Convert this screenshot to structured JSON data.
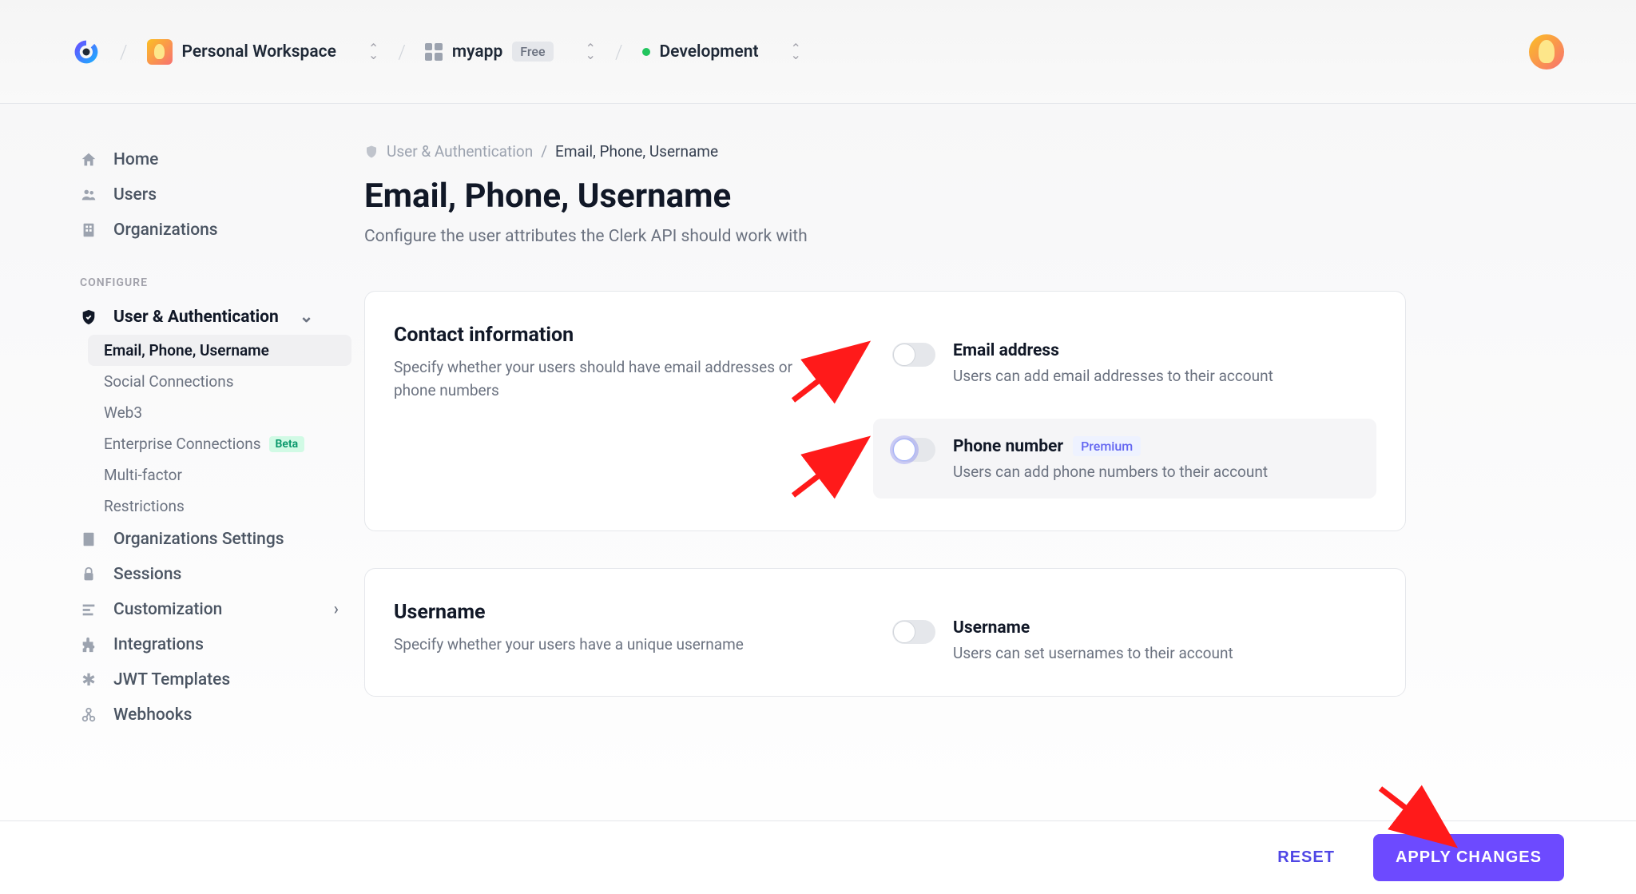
{
  "topbar": {
    "workspace": "Personal Workspace",
    "app": "myapp",
    "app_badge": "Free",
    "environment": "Development"
  },
  "sidebar": {
    "top": [
      {
        "icon": "home",
        "label": "Home"
      },
      {
        "icon": "users",
        "label": "Users"
      },
      {
        "icon": "org",
        "label": "Organizations"
      }
    ],
    "section": "CONFIGURE",
    "auth_label": "User & Authentication",
    "auth_items": [
      {
        "label": "Email, Phone, Username",
        "active": true
      },
      {
        "label": "Social Connections"
      },
      {
        "label": "Web3"
      },
      {
        "label": "Enterprise Connections",
        "badge": "Beta"
      },
      {
        "label": "Multi-factor"
      },
      {
        "label": "Restrictions"
      }
    ],
    "rest": [
      {
        "icon": "org",
        "label": "Organizations Settings"
      },
      {
        "icon": "lock",
        "label": "Sessions"
      },
      {
        "icon": "custom",
        "label": "Customization",
        "chevron": true
      },
      {
        "icon": "puzzle",
        "label": "Integrations"
      },
      {
        "icon": "jwt",
        "label": "JWT Templates"
      },
      {
        "icon": "webhook",
        "label": "Webhooks"
      }
    ]
  },
  "breadcrumb": {
    "parent": "User & Authentication",
    "current": "Email, Phone, Username"
  },
  "page": {
    "title": "Email, Phone, Username",
    "subtitle": "Configure the user attributes the Clerk API should work with"
  },
  "cards": {
    "contact": {
      "title": "Contact information",
      "desc": "Specify whether your users should have email addresses or phone numbers",
      "options": [
        {
          "title": "Email address",
          "desc": "Users can add email addresses to their account"
        },
        {
          "title": "Phone number",
          "desc": "Users can add phone numbers to their account",
          "premium": "Premium"
        }
      ]
    },
    "username": {
      "title": "Username",
      "desc": "Specify whether your users have a unique username",
      "options": [
        {
          "title": "Username",
          "desc": "Users can set usernames to their account"
        }
      ]
    }
  },
  "footer": {
    "reset": "RESET",
    "apply": "APPLY CHANGES"
  }
}
